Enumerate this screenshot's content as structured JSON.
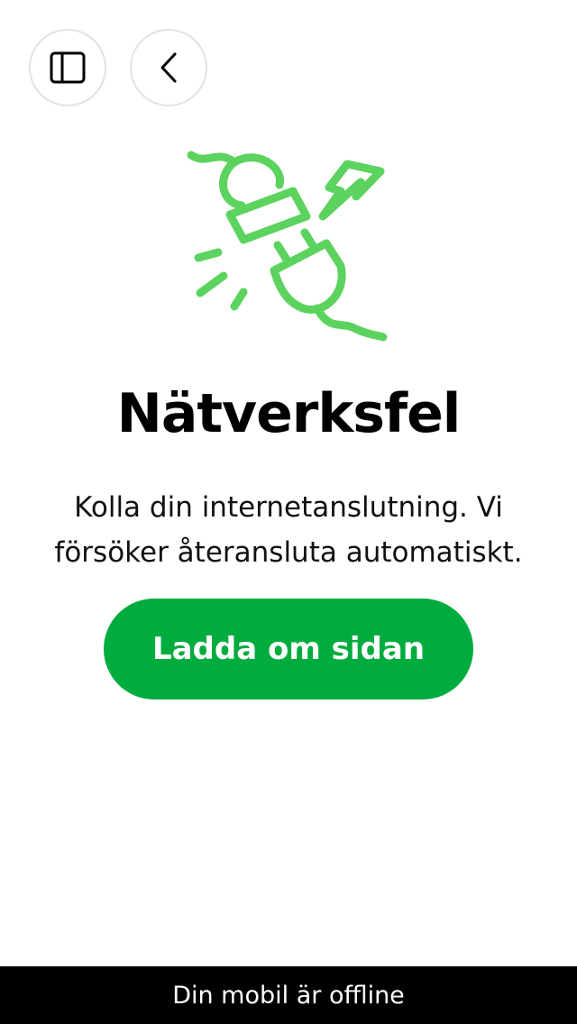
{
  "toolbar": {
    "sidebar_icon": "sidebar-panel-icon",
    "back_icon": "chevron-left-icon"
  },
  "illustration": {
    "icon": "unplugged-plug-icon",
    "color": "#5cd35f"
  },
  "error": {
    "title": "Nätverksfel",
    "message": "Kolla din internetanslutning. Vi försöker återansluta automatiskt."
  },
  "actions": {
    "reload_label": "Ladda om sidan",
    "reload_color": "#00ac3e"
  },
  "status_bar": {
    "text": "Din mobil är offline"
  }
}
